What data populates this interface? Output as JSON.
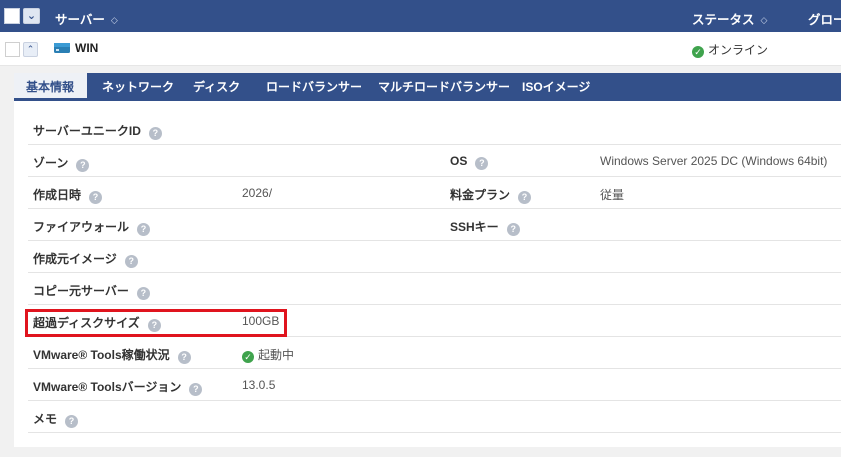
{
  "header": {
    "col_server": "サーバー",
    "col_status": "ステータス",
    "col_global": "グロー"
  },
  "server": {
    "name": "WIN",
    "status": "オンライン"
  },
  "tabs": [
    {
      "label": "基本情報",
      "active": true
    },
    {
      "label": "ネットワーク"
    },
    {
      "label": "ディスク"
    },
    {
      "label": "ロードバランサー"
    },
    {
      "label": "マルチロードバランサー"
    },
    {
      "label": "ISOイメージ"
    }
  ],
  "info": {
    "unique_id": {
      "label": "サーバーユニークID",
      "value": ""
    },
    "zone": {
      "label": "ゾーン",
      "value": ""
    },
    "os": {
      "label": "OS",
      "value": "Windows Server 2025 DC (Windows 64bit)"
    },
    "created": {
      "label": "作成日時",
      "value": "2026/"
    },
    "plan": {
      "label": "料金プラン",
      "value": "従量"
    },
    "firewall": {
      "label": "ファイアウォール",
      "value": ""
    },
    "ssh": {
      "label": "SSHキー",
      "value": ""
    },
    "source_image": {
      "label": "作成元イメージ",
      "value": ""
    },
    "copy_source": {
      "label": "コピー元サーバー",
      "value": ""
    },
    "excess_disk": {
      "label": "超過ディスクサイズ",
      "value": "100GB"
    },
    "vmware_status": {
      "label": "VMware® Tools稼働状況",
      "value": "起動中"
    },
    "vmware_version": {
      "label": "VMware® Toolsバージョン",
      "value": "13.0.5"
    },
    "memo": {
      "label": "メモ",
      "value": ""
    }
  },
  "icons": {
    "help": "?",
    "check": "✓"
  },
  "colors": {
    "header_bg": "#33508a",
    "online_green": "#3fa34d",
    "highlight_red": "#e0141e"
  }
}
